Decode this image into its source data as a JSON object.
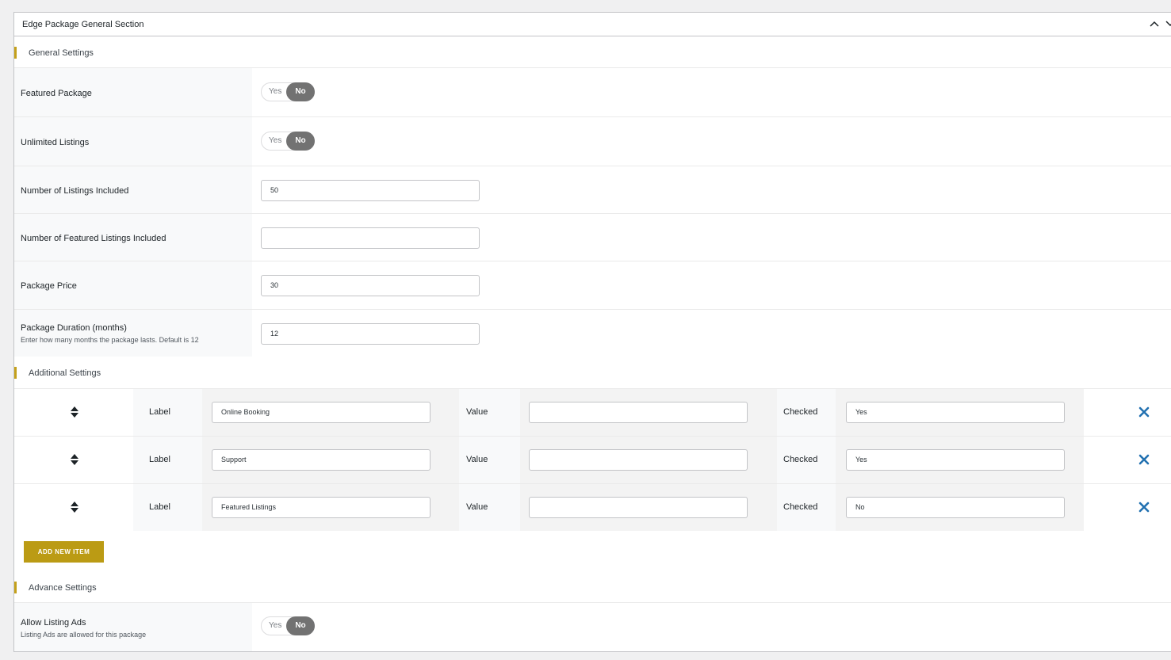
{
  "panel": {
    "title": "Edge Package General Section"
  },
  "colors": {
    "accent": "#c4a01b",
    "button": "#bb9b14",
    "toggle_on": "#727272",
    "remove_icon": "#2271b1"
  },
  "icons": {
    "collapse": "chevron-up-icon",
    "move": "chevron-down-icon",
    "sort": "sort-icon",
    "remove": "close-icon"
  },
  "sections": {
    "general": "General Settings",
    "additional": "Additional Settings",
    "advance": "Advance Settings"
  },
  "general": {
    "featured_package": {
      "label": "Featured Package",
      "yes": "Yes",
      "no": "No",
      "value": "No"
    },
    "unlimited_listings": {
      "label": "Unlimited Listings",
      "yes": "Yes",
      "no": "No",
      "value": "No"
    },
    "listings_included": {
      "label": "Number of Listings Included",
      "value": "50"
    },
    "featured_listings_included": {
      "label": "Number of Featured Listings Included",
      "value": ""
    },
    "package_price": {
      "label": "Package Price",
      "value": "30"
    },
    "package_duration": {
      "label": "Package Duration (months)",
      "description": "Enter how many months the package lasts. Default is 12",
      "value": "12"
    }
  },
  "additional": {
    "field_labels": {
      "label": "Label",
      "value": "Value",
      "checked": "Checked"
    },
    "items": [
      {
        "label": "Online Booking",
        "value": "",
        "checked": "Yes"
      },
      {
        "label": "Support",
        "value": "",
        "checked": "Yes"
      },
      {
        "label": "Featured Listings",
        "value": "",
        "checked": "No"
      }
    ],
    "add_button": "ADD NEW ITEM"
  },
  "advance": {
    "allow_listing_ads": {
      "label": "Allow Listing Ads",
      "description": "Listing Ads are allowed for this package",
      "yes": "Yes",
      "no": "No",
      "value": "No"
    }
  }
}
